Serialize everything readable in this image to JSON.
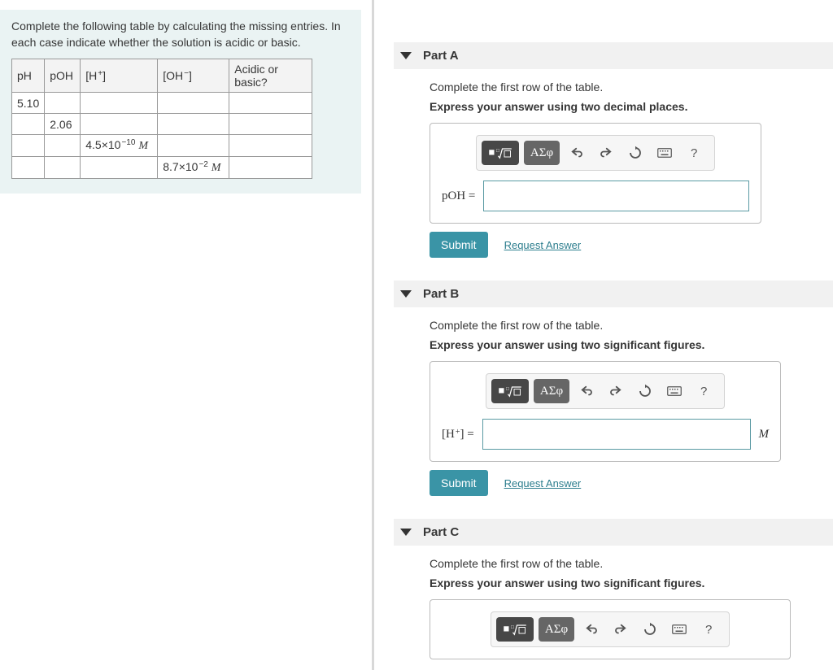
{
  "question": {
    "prompt": "Complete the following table by calculating the missing entries. In each case indicate whether the solution is acidic or basic.",
    "columns": {
      "ph": "pH",
      "poh": "pOH",
      "h": "[H",
      "h_sup": "+",
      "oh": "[OH",
      "oh_sup": "−",
      "ab": "Acidic or basic?"
    },
    "rows": {
      "r1": {
        "ph": "5.10"
      },
      "r2": {
        "poh": "2.06"
      },
      "r3": {
        "h_text": "4.5×10",
        "h_exp": "−10",
        "h_unit": "M"
      },
      "r4": {
        "oh_text": "8.7×10",
        "oh_exp": "−2",
        "oh_unit": "M"
      }
    }
  },
  "toolbar": {
    "undo": "↶",
    "redo": "↷",
    "reset": "⟳",
    "keyboard": "⌨",
    "help": "?",
    "sigma": "ΑΣφ"
  },
  "parts": {
    "a": {
      "title": "Part A",
      "line1": "Complete the first row of the table.",
      "line2": "Express your answer using two decimal places.",
      "label": "pOH ="
    },
    "b": {
      "title": "Part B",
      "line1": "Complete the first row of the table.",
      "line2": "Express your answer using two significant figures.",
      "label_pre": "[H",
      "label_sup": "+",
      "label_post": "] =",
      "unit": "M"
    },
    "c": {
      "title": "Part C",
      "line1": "Complete the first row of the table.",
      "line2": "Express your answer using two significant figures."
    }
  },
  "buttons": {
    "submit": "Submit",
    "request": "Request Answer"
  }
}
